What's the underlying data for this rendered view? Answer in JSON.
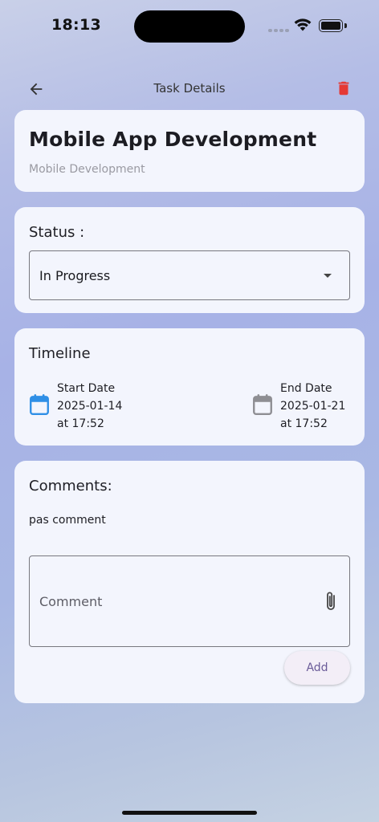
{
  "status_bar": {
    "time": "18:13"
  },
  "app_bar": {
    "title": "Task Details"
  },
  "task": {
    "title": "Mobile App Development",
    "category": "Mobile Development"
  },
  "status": {
    "label": "Status :",
    "selected": "In Progress"
  },
  "timeline": {
    "label": "Timeline",
    "start": {
      "label": "Start Date",
      "date": "2025-01-14",
      "time": "at 17:52"
    },
    "end": {
      "label": "End Date",
      "date": "2025-01-21",
      "time": "at 17:52"
    }
  },
  "comments": {
    "label": "Comments:",
    "items": [
      "pas comment"
    ],
    "input_placeholder": "Comment",
    "add_label": "Add"
  },
  "colors": {
    "delete": "#e53935",
    "calendar_active": "#2f8fe6",
    "calendar_inactive": "#8e8e93",
    "button_text": "#6a5b98"
  },
  "icons": {
    "back": "arrow-left-icon",
    "delete": "trash-icon",
    "calendar": "calendar-icon",
    "attach": "paperclip-icon",
    "dropdown": "caret-down-icon"
  }
}
